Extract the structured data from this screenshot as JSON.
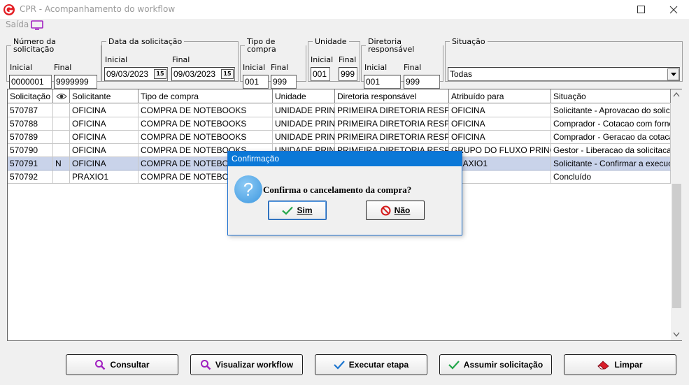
{
  "window": {
    "title": "CPR - Acompanhamento do workflow",
    "brand_color": "#e31e24"
  },
  "menu": {
    "saida": "Saída"
  },
  "filters": {
    "numero": {
      "legend": "Número da solicitação",
      "inicial_label": "Inicial",
      "final_label": "Final",
      "inicial": "0000001",
      "final": "9999999"
    },
    "data": {
      "legend": "Data da solicitação",
      "inicial_label": "Inicial",
      "final_label": "Final",
      "inicial": "09/03/2023",
      "final": "09/03/2023",
      "cal_label": "15"
    },
    "tipo": {
      "legend": "Tipo de compra",
      "inicial_label": "Inicial",
      "final_label": "Final",
      "inicial": "001",
      "final": "999"
    },
    "unidade": {
      "legend": "Unidade",
      "inicial_label": "Inicial",
      "final_label": "Final",
      "inicial": "001",
      "final": "999"
    },
    "diretoria": {
      "legend": "Diretoria responsável",
      "inicial_label": "Inicial",
      "final_label": "Final",
      "inicial": "001",
      "final": "999"
    },
    "situacao": {
      "legend": "Situação",
      "value": "Todas"
    }
  },
  "grid": {
    "columns": [
      "Solicitação",
      "",
      "Solicitante",
      "Tipo de compra",
      "Unidade",
      "Diretoria responsável",
      "Atribuído para",
      "Situação"
    ],
    "rows": [
      {
        "solicitacao": "570787",
        "flag": "",
        "solicitante": "OFICINA",
        "tipo": "COMPRA DE NOTEBOOKS",
        "unidade": "UNIDADE PRIN...",
        "diretoria": "PRIMEIRA DIRETORIA RESP...",
        "atribuido": "OFICINA",
        "situacao": "Solicitante - Aprovacao do solicit..."
      },
      {
        "solicitacao": "570788",
        "flag": "",
        "solicitante": "OFICINA",
        "tipo": "COMPRA DE NOTEBOOKS",
        "unidade": "UNIDADE PRIN...",
        "diretoria": "PRIMEIRA DIRETORIA RESP...",
        "atribuido": "OFICINA",
        "situacao": "Comprador - Cotacao com fornec..."
      },
      {
        "solicitacao": "570789",
        "flag": "",
        "solicitante": "OFICINA",
        "tipo": "COMPRA DE NOTEBOOKS",
        "unidade": "UNIDADE PRIN...",
        "diretoria": "PRIMEIRA DIRETORIA RESP...",
        "atribuido": "OFICINA",
        "situacao": "Comprador - Geracao da cotacao"
      },
      {
        "solicitacao": "570790",
        "flag": "",
        "solicitante": "OFICINA",
        "tipo": "COMPRA DE NOTEBOOKS",
        "unidade": "UNIDADE PRIN...",
        "diretoria": "PRIMEIRA DIRETORIA RESP...",
        "atribuido": "GRUPO DO FLUXO PRINC...",
        "situacao": "Gestor - Liberacao da solicitacao ..."
      },
      {
        "solicitacao": "570791",
        "flag": "N",
        "solicitante": "OFICINA",
        "tipo": "COMPRA DE NOTEBOOKS",
        "unidade": "",
        "diretoria": "",
        "atribuido": "PRAXIO1",
        "situacao": "Solicitante - Confirmar a execuca..."
      },
      {
        "solicitacao": "570792",
        "flag": "",
        "solicitante": "PRAXIO1",
        "tipo": "COMPRA DE NOTEBOOKS",
        "unidade": "",
        "diretoria": "",
        "atribuido": "",
        "situacao": "Concluído"
      }
    ]
  },
  "buttons": {
    "consultar": "Consultar",
    "visualizar": "Visualizar workflow",
    "executar": "Executar etapa",
    "assumir": "Assumir solicitação",
    "limpar": "Limpar"
  },
  "dialog": {
    "title": "Confirmação",
    "message": "Confirma o cancelamento da compra?",
    "yes": "Sim",
    "no": "Não",
    "icon_glyph": "?"
  }
}
